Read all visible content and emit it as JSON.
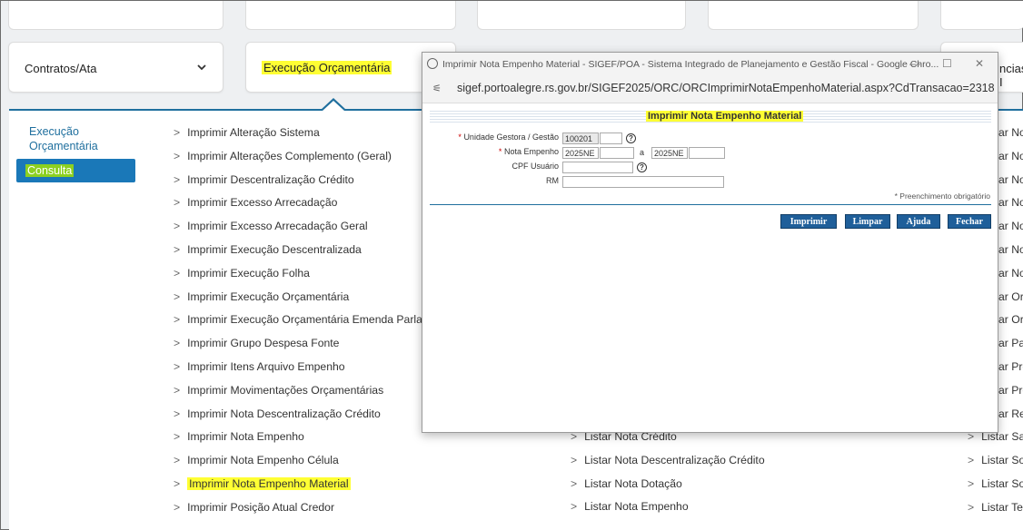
{
  "nav": {
    "cards": [
      {
        "label": "Contratos/Ata",
        "has_chevron": true
      },
      {
        "label": "Execução Orçamentária",
        "highlighted": true
      },
      {
        "label": "ncias I"
      }
    ]
  },
  "sidebar": {
    "title": "Execução Orçamentária",
    "button": "Consulta"
  },
  "menu": {
    "left": [
      "Imprimir Alteração Sistema",
      "Imprimir Alterações Complemento (Geral)",
      "Imprimir Descentralização Crédito",
      "Imprimir Excesso Arrecadação",
      "Imprimir Excesso Arrecadação Geral",
      "Imprimir Execução Descentralizada",
      "Imprimir Execução Folha",
      "Imprimir Execução Orçamentária",
      "Imprimir Execução Orçamentária Emenda Parlame",
      "Imprimir Grupo Despesa Fonte",
      "Imprimir Itens Arquivo Empenho",
      "Imprimir Movimentações Orçamentárias",
      "Imprimir Nota Descentralização Crédito",
      "Imprimir Nota Empenho",
      "Imprimir Nota Empenho Célula",
      "Imprimir Nota Empenho Material",
      "Imprimir Posição Atual Credor"
    ],
    "middle": [
      "Listar Nota Crédito",
      "Listar Nota Descentralização Crédito",
      "Listar Nota Dotação",
      "Listar Nota Empenho"
    ],
    "right": [
      "ar No",
      "ar No",
      "ar No",
      "ar No",
      "ar No",
      "ar No",
      "ar No",
      "ar Orc",
      "ar Orc",
      "ar Pa",
      "ar Pré",
      "ar Pré",
      "ar Rer",
      "Listar Sal",
      "Listar Sol",
      "Listar Sol",
      "Listar Tet"
    ],
    "arrow": ">"
  },
  "popup": {
    "window_title": "Imprimir Nota Empenho Material - SIGEF/POA - Sistema Integrado de Planejamento e Gestão Fiscal - Google Chro...",
    "url": "sigef.portoalegre.rs.gov.br/SIGEF2025/ORC/ORCImprimirNotaEmpenhoMaterial.aspx?CdTransacao=2318",
    "controls": {
      "minimize": "—",
      "maximize": "☐",
      "close": "✕"
    },
    "form_title": "Imprimir Nota Empenho Material",
    "fields": {
      "unidade_label": "Unidade Gestora / Gestão",
      "unidade_value": "100201",
      "nota_label": "Nota Empenho",
      "nota_from": "2025NE",
      "nota_sep": "a",
      "nota_to": "2025NE",
      "cpf_label": "CPF Usuário",
      "rm_label": "RM",
      "required_mark": "*",
      "help_glyph": "?"
    },
    "required_note": "* Preenchimento obrigatório",
    "buttons": {
      "print": "Imprimir",
      "clear": "Limpar",
      "help": "Ajuda",
      "close": "Fechar"
    }
  },
  "colors": {
    "accent": "#1f6f9e",
    "highlight": "#ffff33",
    "sidebar_button": "#1a78b8",
    "form_button": "#1f5f9a"
  }
}
